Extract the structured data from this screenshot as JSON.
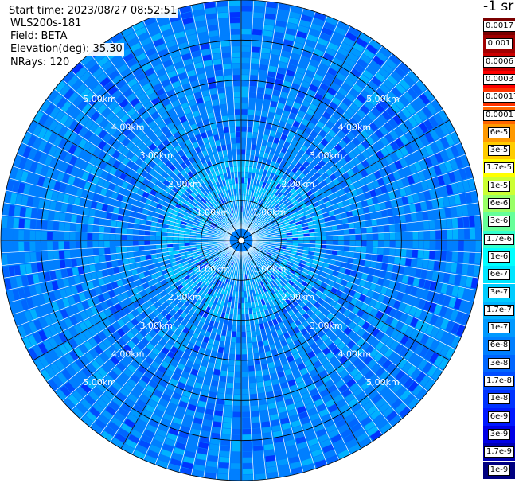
{
  "header": {
    "start_time": "Start time: 2023/08/27 08:52:51",
    "instrument": "WLS200s-181",
    "field": "Field: BETA",
    "elevation": "Elevation(deg): 35.30",
    "nrays": "NRays: 120"
  },
  "legend": {
    "unit_label": "-1 sr",
    "entries": [
      {
        "label": "0.0017",
        "color": "#7a0000"
      },
      {
        "label": "0.001",
        "color": "#a00000"
      },
      {
        "label": "0.0006",
        "color": "#cc0000"
      },
      {
        "label": "0.0003",
        "color": "#ff0000"
      },
      {
        "label": "0.00017",
        "color": "#ff3300"
      },
      {
        "label": "0.0001",
        "color": "#ff6600"
      },
      {
        "label": "6e-5",
        "color": "#ff9900"
      },
      {
        "label": "3e-5",
        "color": "#ffcc00"
      },
      {
        "label": "1.7e-5",
        "color": "#ffff00"
      },
      {
        "label": "1e-5",
        "color": "#ccff33"
      },
      {
        "label": "6e-6",
        "color": "#99ff66"
      },
      {
        "label": "3e-6",
        "color": "#66ff99"
      },
      {
        "label": "1.7e-6",
        "color": "#33ffcc"
      },
      {
        "label": "1e-6",
        "color": "#00ffff"
      },
      {
        "label": "6e-7",
        "color": "#00e5ff"
      },
      {
        "label": "3e-7",
        "color": "#00ccff"
      },
      {
        "label": "1.7e-7",
        "color": "#00b2ff"
      },
      {
        "label": "1e-7",
        "color": "#0099ff"
      },
      {
        "label": "6e-8",
        "color": "#007fff"
      },
      {
        "label": "3e-8",
        "color": "#0066ff"
      },
      {
        "label": "1.7e-8",
        "color": "#004cff"
      },
      {
        "label": "1e-8",
        "color": "#0033ff"
      },
      {
        "label": "6e-9",
        "color": "#0019ff"
      },
      {
        "label": "3e-9",
        "color": "#0000e6"
      },
      {
        "label": "1.7e-9",
        "color": "#0000b3"
      },
      {
        "label": "1e-9",
        "color": "#000080"
      }
    ]
  },
  "chart_data": {
    "type": "heatmap",
    "projection": "polar (PPI scan)",
    "field": "BETA",
    "rays": 120,
    "max_range_km": 6.0,
    "range_rings_km": [
      1.0,
      2.0,
      3.0,
      4.0,
      5.0
    ],
    "ring_labels": [
      "1.00km",
      "2.00km",
      "3.00km",
      "4.00km",
      "5.00km"
    ],
    "spokes_deg": [
      0,
      30,
      60,
      90,
      120,
      150,
      180,
      210,
      240,
      270,
      300,
      330
    ],
    "dominant_level": "6e-8",
    "value_range": [
      "3e-9",
      "1.7e-7"
    ],
    "near_range_level": "3e-7",
    "legend_colors": [
      "#7a0000",
      "#a00000",
      "#cc0000",
      "#ff0000",
      "#ff3300",
      "#ff6600",
      "#ff9900",
      "#ffcc00",
      "#ffff00",
      "#ccff33",
      "#99ff66",
      "#66ff99",
      "#33ffcc",
      "#00ffff",
      "#00e5ff",
      "#00ccff",
      "#00b2ff",
      "#0099ff",
      "#007fff",
      "#0066ff",
      "#004cff",
      "#0033ff",
      "#0019ff",
      "#0000e6",
      "#0000b3",
      "#000080"
    ]
  }
}
